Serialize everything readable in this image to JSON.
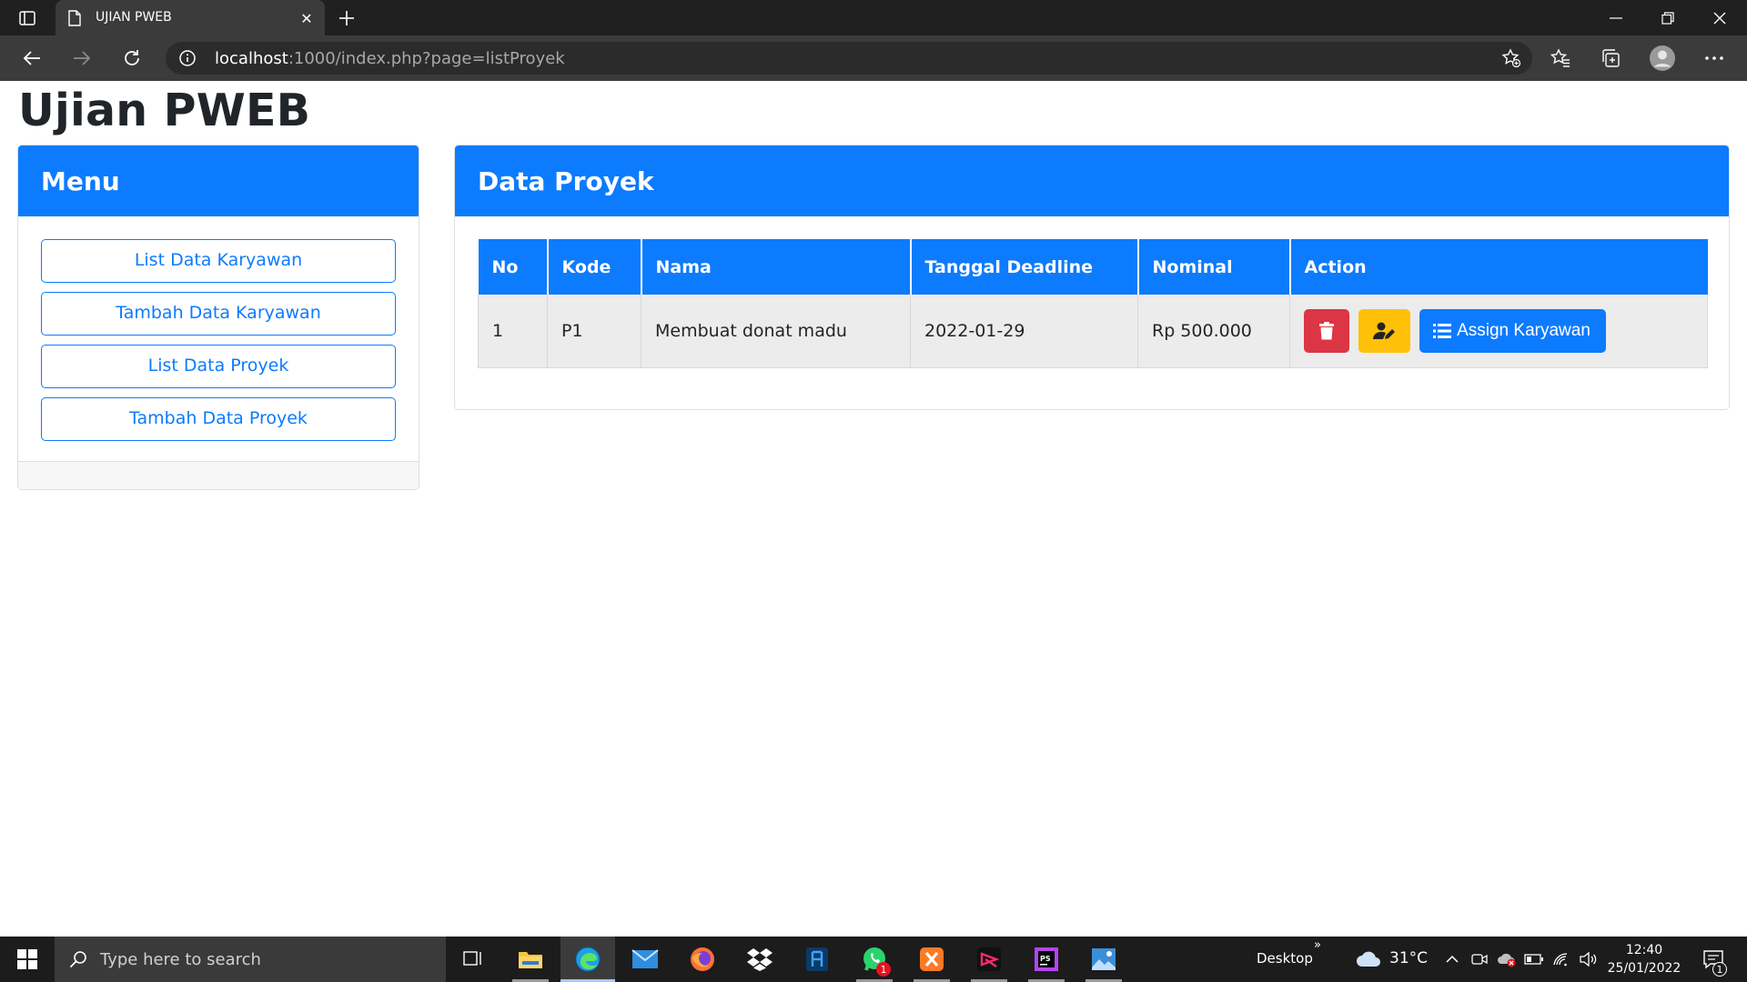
{
  "browser": {
    "tab_title": "UJIAN PWEB",
    "address_host": "localhost",
    "address_path": ":1000/index.php?page=listProyek"
  },
  "page": {
    "title": "Ujian PWEB"
  },
  "menu": {
    "title": "Menu",
    "items": [
      {
        "label": "List Data Karyawan"
      },
      {
        "label": "Tambah Data Karyawan"
      },
      {
        "label": "List Data Proyek"
      },
      {
        "label": "Tambah Data Proyek"
      }
    ]
  },
  "projects": {
    "title": "Data Proyek",
    "columns": [
      "No",
      "Kode",
      "Nama",
      "Tanggal Deadline",
      "Nominal",
      "Action"
    ],
    "rows": [
      {
        "no": "1",
        "kode": "P1",
        "nama": "Membuat donat madu",
        "deadline": "2022-01-29",
        "nominal": "Rp 500.000",
        "assign_label": "Assign Karyawan"
      }
    ]
  },
  "taskbar": {
    "search_placeholder": "Type here to search",
    "desktop_label": "Desktop",
    "weather_temp": "31°C",
    "time": "12:40",
    "date": "25/01/2022",
    "whatsapp_badge": "1",
    "notification_count": "1"
  },
  "colors": {
    "primary": "#0d7bfd",
    "danger": "#dc3545",
    "warning": "#ffc107",
    "row_bg": "#ececec"
  }
}
